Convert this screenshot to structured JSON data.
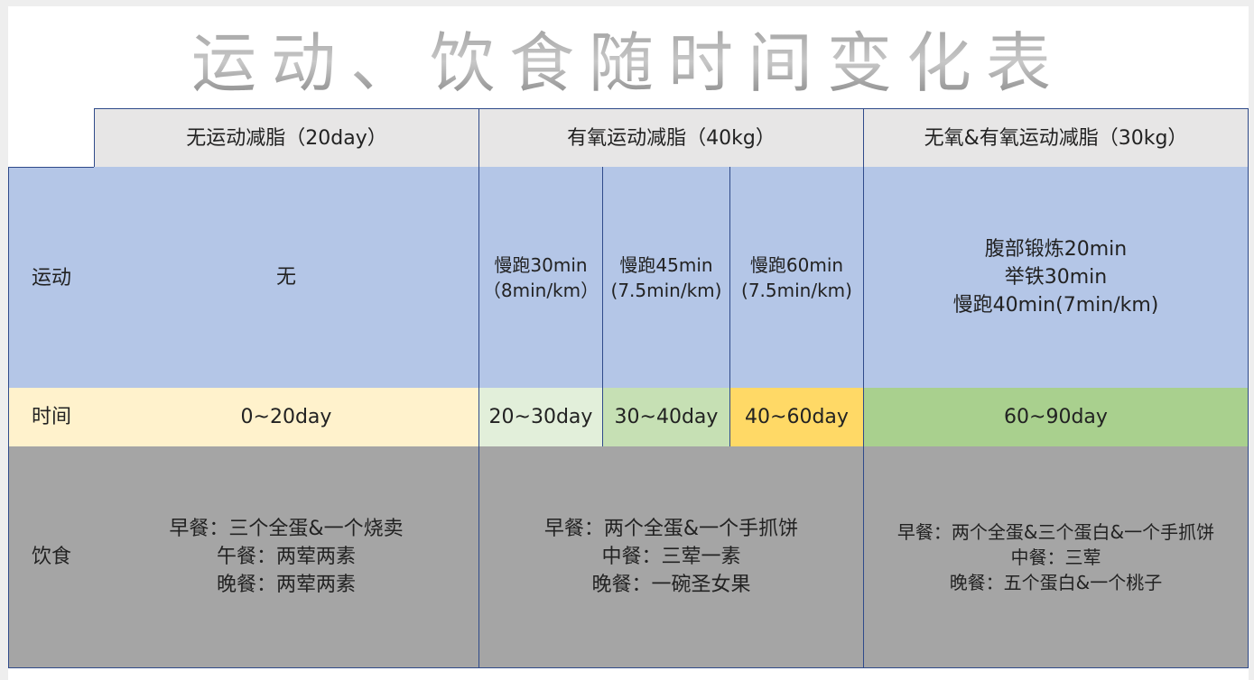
{
  "title": "运动、饮食随时间变化表",
  "header": {
    "col1": "无运动减脂（20day）",
    "col2": "有氧运动减脂（40kg）",
    "col3": "无氧&有氧运动减脂（30kg）"
  },
  "rows": {
    "exercise_label": "运动",
    "time_label": "时间",
    "diet_label": "饮食"
  },
  "exercise": {
    "p1": "无",
    "p2a": [
      "慢跑30min",
      "（8min/km）"
    ],
    "p2b": [
      "慢跑45min",
      "(7.5min/km)"
    ],
    "p2c": [
      "慢跑60min",
      "(7.5min/km)"
    ],
    "p3": [
      "腹部锻炼20min",
      "举铁30min",
      "慢跑40min(7min/km)"
    ]
  },
  "time": {
    "p1": "0~20day",
    "p2a": "20~30day",
    "p2b": "30~40day",
    "p2c": "40~60day",
    "p3": "60~90day"
  },
  "diet": {
    "p1": [
      "早餐：三个全蛋&一个烧卖",
      "午餐：两荤两素",
      "晚餐：两荤两素"
    ],
    "p2": [
      "早餐：两个全蛋&一个手抓饼",
      "中餐：三荤一素",
      "晚餐：一碗圣女果"
    ],
    "p3": [
      "早餐：两个全蛋&三个蛋白&一个手抓饼",
      "中餐：三荤",
      "晚餐：五个蛋白&一个桃子"
    ]
  },
  "colors": {
    "header_bg": "#e7e6e6",
    "exercise_bg": "#b4c6e7",
    "time_p1": "#fff2cc",
    "time_p2a": "#e2efda",
    "time_p2b": "#c6e0b4",
    "time_p2c": "#ffd966",
    "time_p3": "#a9d08e",
    "diet_bg": "#a5a5a5",
    "border": "#2f4a8a"
  }
}
